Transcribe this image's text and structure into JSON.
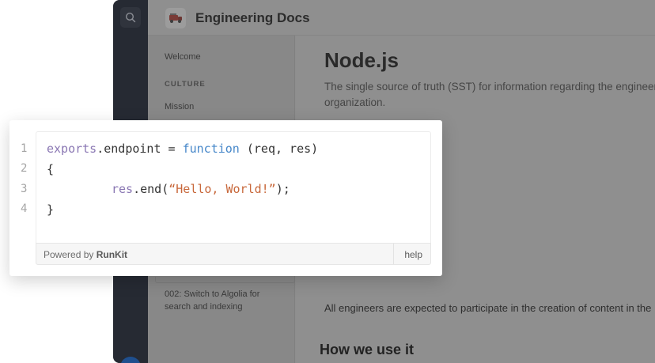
{
  "app": {
    "title": "Engineering Docs",
    "icons": {
      "search": "search-icon",
      "logo": "fire-truck-icon"
    }
  },
  "sidebar": {
    "items": [
      {
        "type": "link",
        "label": "Welcome"
      },
      {
        "type": "section",
        "label": "CULTURE"
      },
      {
        "type": "link",
        "label": "Mission"
      },
      {
        "type": "link",
        "label": "002: Switch to Algolia for"
      },
      {
        "type": "link",
        "label": "search and indexing"
      }
    ]
  },
  "content": {
    "title": "Node.js",
    "lead_line1": "The single source of truth (SST) for information regarding the engineering",
    "lead_line2": "organization.",
    "paragraph": "All engineers are expected to participate in the creation of content in the",
    "heading2": "How we use it"
  },
  "runkit": {
    "line_numbers": [
      "1",
      "2",
      "3",
      "4"
    ],
    "code": {
      "l1_obj": "exports",
      "l1_dot": ".endpoint = ",
      "l1_kw": "function",
      "l1_rest": " (req, res)",
      "l2": "{",
      "l3_obj": "res",
      "l3_call": ".end(",
      "l3_str": "“Hello, World!”",
      "l3_end": ");",
      "l4": "}"
    },
    "footer": {
      "powered_prefix": "Powered by ",
      "brand": "RunKit",
      "help": "help"
    },
    "colors": {
      "keyword_purple": "#8a77b3",
      "keyword_blue": "#4687c9",
      "string": "#c8683b"
    }
  }
}
